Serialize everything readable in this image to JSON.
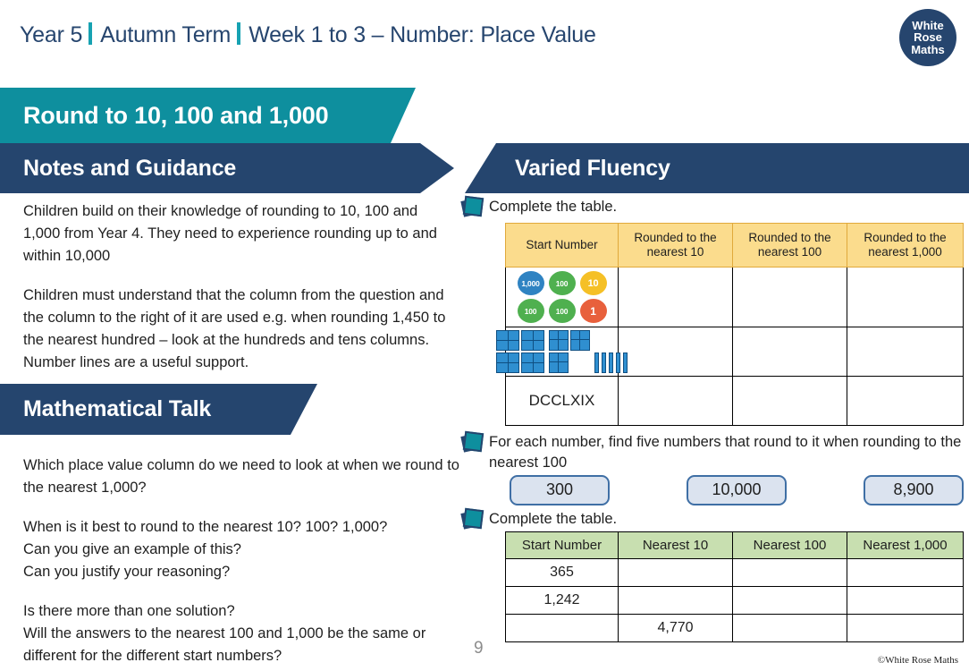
{
  "header": {
    "year": "Year 5",
    "term": "Autumn Term",
    "topic": "Week 1 to 3 – Number: Place Value"
  },
  "logo": {
    "line1": "White",
    "line2": "Rose",
    "line3": "Maths"
  },
  "banners": {
    "title": "Round to 10, 100 and 1,000",
    "notes": "Notes and Guidance",
    "talk": "Mathematical Talk",
    "varied_fluency": "Varied Fluency"
  },
  "notes": {
    "p1": "Children build on their knowledge of rounding to 10, 100 and 1,000 from Year 4. They need to experience rounding up to and within 10,000",
    "p2": "Children must understand that the column from the question and the column to the right of it are used e.g. when rounding 1,450 to the nearest hundred – look at the hundreds and tens columns.  Number lines are a useful support."
  },
  "talk": {
    "p1": "Which place value column do we need to look at when we round to the nearest 1,000?",
    "p2": "When is it best to round to the nearest 10? 100? 1,000?\nCan you give an example of this?\nCan you justify your reasoning?",
    "p3": "Is there more than one solution?\nWill the answers to the nearest 100 and 1,000 be the same or different for the different start numbers?"
  },
  "questions": {
    "q1": "Complete the table.",
    "q2": "For each number, find five numbers that round to it when rounding to the nearest 100",
    "q3": "Complete the table."
  },
  "table_vf": {
    "headers": [
      "Start Number",
      "Rounded to the nearest 10",
      "Rounded to the nearest 100",
      "Rounded to the nearest 1,000"
    ],
    "header_lines": [
      [
        "Start Number"
      ],
      [
        "Rounded to the",
        "nearest 10"
      ],
      [
        "Rounded to the",
        "nearest 100"
      ],
      [
        "Rounded to the",
        "nearest 1,000"
      ]
    ],
    "rows": [
      {
        "start_type": "counters",
        "start_value": "",
        "nearest_10": "",
        "nearest_100": "",
        "nearest_1000": ""
      },
      {
        "start_type": "blocks",
        "start_value": "",
        "nearest_10": "",
        "nearest_100": "",
        "nearest_1000": ""
      },
      {
        "start_type": "text",
        "start_value": "DCCLXIX",
        "nearest_10": "",
        "nearest_100": "",
        "nearest_1000": ""
      }
    ],
    "counters": [
      {
        "label": "1,000",
        "color_class": "c-1000"
      },
      {
        "label": "100",
        "color_class": "c-100"
      },
      {
        "label": "10",
        "color_class": "c-10"
      },
      {
        "label": "100",
        "color_class": "c-100"
      },
      {
        "label": "100",
        "color_class": "c-100"
      },
      {
        "label": "1",
        "color_class": "c-1"
      }
    ],
    "blocks": {
      "thousands": 4,
      "hundreds": 3,
      "tens": 5
    }
  },
  "number_boxes": [
    "300",
    "10,000",
    "8,900"
  ],
  "table_bottom": {
    "headers": [
      "Start Number",
      "Nearest 10",
      "Nearest 100",
      "Nearest 1,000"
    ],
    "rows": [
      [
        "365",
        "",
        "",
        ""
      ],
      [
        "1,242",
        "",
        "",
        ""
      ],
      [
        "",
        "4,770",
        "",
        ""
      ]
    ]
  },
  "footer": {
    "page_number": "9",
    "copyright": "©White Rose Maths"
  },
  "colors": {
    "navy": "#25456e",
    "teal": "#0e8f9e",
    "yellow_header": "#fbdc8d",
    "green_header": "#c8dfb0",
    "box_fill": "#dbe3ef",
    "box_border": "#3f6fa5"
  }
}
